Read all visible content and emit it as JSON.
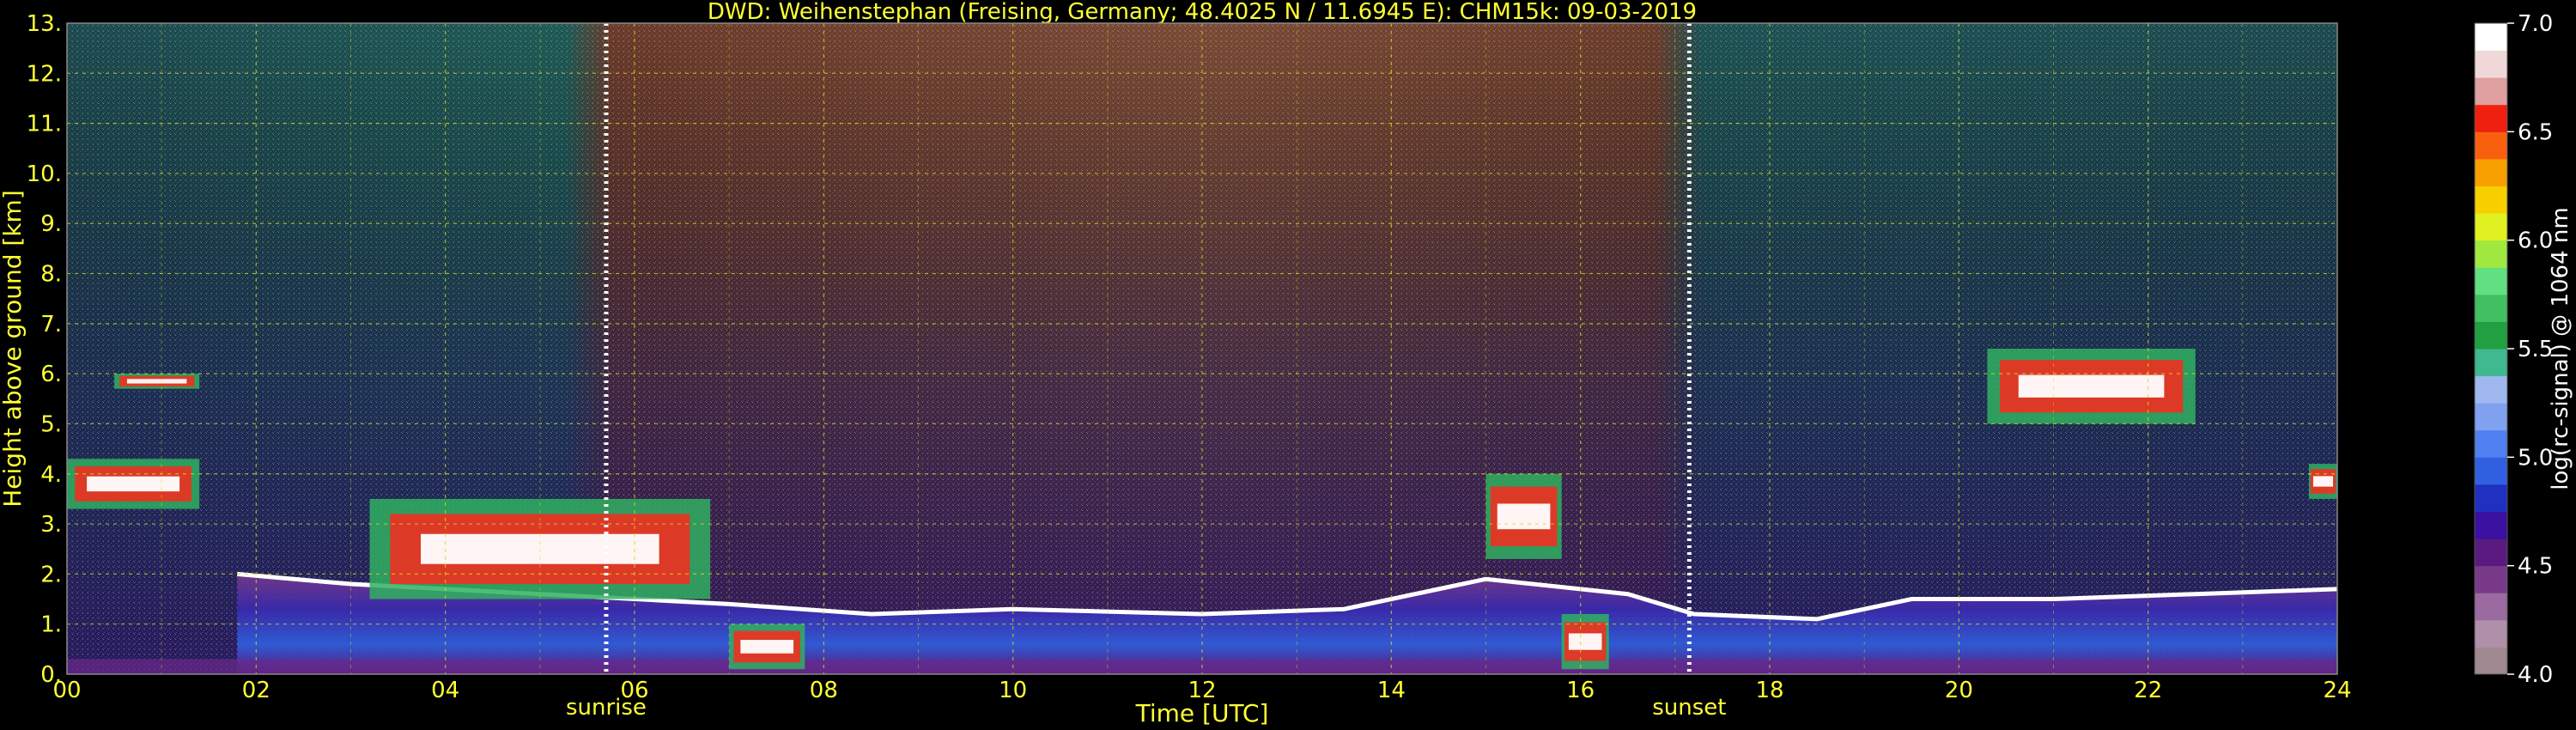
{
  "chart_data": {
    "type": "heatmap",
    "title": "DWD: Weihenstephan (Freising, Germany; 48.4025 N / 11.6945 E):    CHM15k: 09-03-2019",
    "xlabel": "Time [UTC]",
    "ylabel": "Height above ground [km]",
    "xlim": [
      0,
      24
    ],
    "ylim": [
      0,
      13
    ],
    "x_ticks": [
      "00",
      "02",
      "04",
      "06",
      "08",
      "10",
      "12",
      "14",
      "16",
      "18",
      "20",
      "22",
      "24"
    ],
    "y_ticks": [
      "0.",
      "1.",
      "2.",
      "3.",
      "4.",
      "5.",
      "6.",
      "7.",
      "8.",
      "9.",
      "10.",
      "11.",
      "12.",
      "13."
    ],
    "grid": true,
    "colorbar": {
      "label": "log(rc-signal) @ 1064 nm",
      "range": [
        4.0,
        7.0
      ],
      "ticks": [
        "4.0",
        "4.5",
        "5.0",
        "5.5",
        "6.0",
        "6.5",
        "7.0"
      ],
      "colors": [
        "#a08890",
        "#b090a8",
        "#9a6aa0",
        "#7a3a8a",
        "#5a1a80",
        "#3a10a0",
        "#2030c0",
        "#3060e0",
        "#5080f0",
        "#80a0f0",
        "#a0b8f0",
        "#40b890",
        "#20a040",
        "#40c060",
        "#60e080",
        "#a0e840",
        "#e0f020",
        "#f8d000",
        "#f8a000",
        "#f86010",
        "#f02010",
        "#e0a0a0",
        "#f0d8d8",
        "#ffffff"
      ]
    },
    "annotations": [
      {
        "label": "sunrise",
        "x": 5.7
      },
      {
        "label": "sunset",
        "x": 17.15
      }
    ],
    "features": [
      {
        "kind": "cloud",
        "t_start": 0.0,
        "t_end": 1.4,
        "h_bottom": 3.3,
        "h_top": 4.3
      },
      {
        "kind": "cloud",
        "t_start": 0.5,
        "t_end": 1.4,
        "h_bottom": 5.7,
        "h_top": 6.0
      },
      {
        "kind": "cloud",
        "t_start": 3.2,
        "t_end": 6.8,
        "h_bottom": 1.5,
        "h_top": 3.5
      },
      {
        "kind": "cloud",
        "t_start": 7.0,
        "t_end": 7.8,
        "h_bottom": 0.1,
        "h_top": 1.0
      },
      {
        "kind": "cloud",
        "t_start": 15.0,
        "t_end": 15.8,
        "h_bottom": 2.3,
        "h_top": 4.0
      },
      {
        "kind": "cloud",
        "t_start": 15.8,
        "t_end": 16.3,
        "h_bottom": 0.1,
        "h_top": 1.2
      },
      {
        "kind": "cloud",
        "t_start": 20.3,
        "t_end": 22.5,
        "h_bottom": 5.0,
        "h_top": 6.5
      },
      {
        "kind": "cloud",
        "t_start": 23.7,
        "t_end": 24.0,
        "h_bottom": 3.5,
        "h_top": 4.2
      },
      {
        "kind": "boundary_layer",
        "points": [
          [
            1.8,
            2.0
          ],
          [
            3.0,
            1.8
          ],
          [
            5.0,
            1.6
          ],
          [
            7.0,
            1.4
          ],
          [
            8.5,
            1.2
          ],
          [
            10.0,
            1.3
          ],
          [
            12.0,
            1.2
          ],
          [
            13.5,
            1.3
          ],
          [
            14.5,
            1.7
          ],
          [
            15.0,
            1.9
          ],
          [
            16.5,
            1.6
          ],
          [
            17.2,
            1.2
          ],
          [
            18.5,
            1.1
          ],
          [
            19.5,
            1.5
          ],
          [
            21.0,
            1.5
          ],
          [
            22.5,
            1.6
          ],
          [
            24.0,
            1.7
          ]
        ]
      }
    ]
  }
}
